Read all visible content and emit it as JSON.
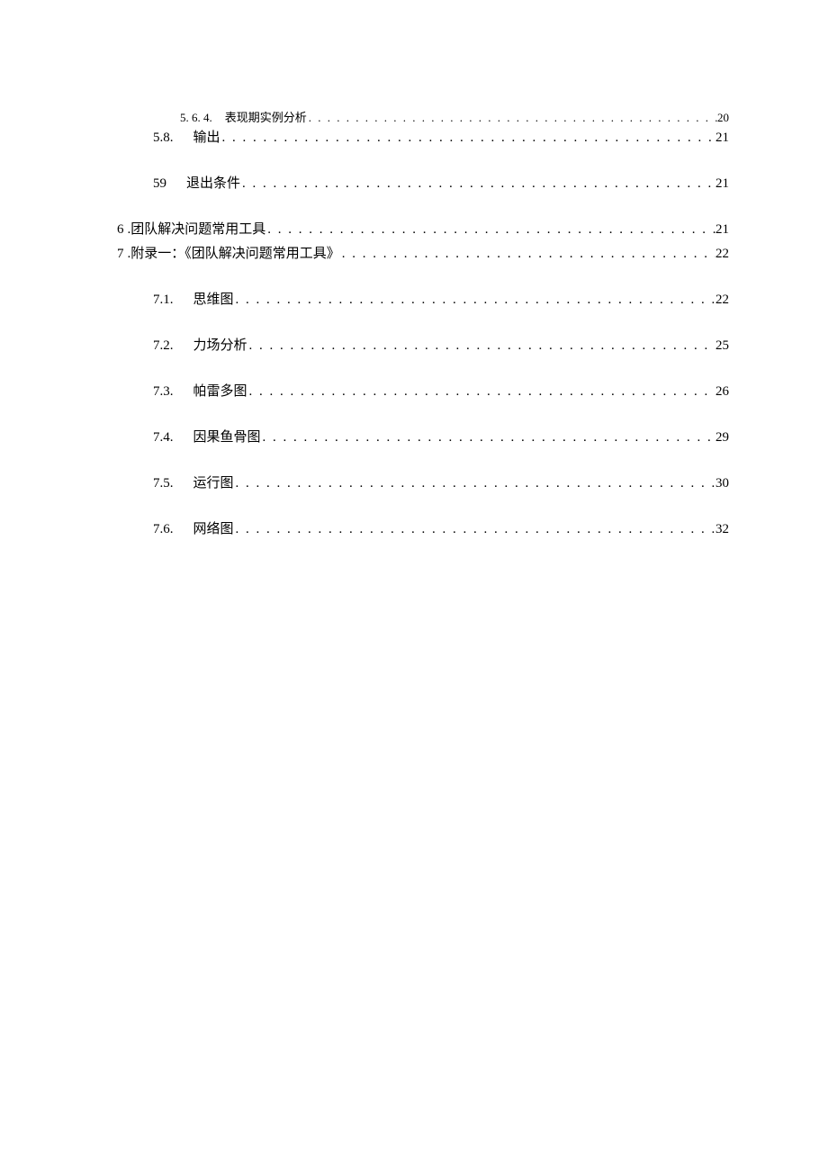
{
  "toc": [
    {
      "indent": 2,
      "num": "5. 6. 4.",
      "title": "表现期实例分析",
      "page": "20",
      "gap": "gap-top"
    },
    {
      "indent": 1,
      "num": "5.8.",
      "title": "输出",
      "page": "21",
      "gap": "gap-large"
    },
    {
      "indent": 1,
      "num": "59",
      "title": "退出条件",
      "page": "21",
      "gap": "gap-med"
    },
    {
      "indent": 0,
      "num": "6",
      "title": ".团队解决问题常用工具",
      "page": "21",
      "gap": ""
    },
    {
      "indent": 0,
      "num": "7",
      "title": ".附录一：《团队解决问题常用工具》",
      "page": "22",
      "gap": "gap-med"
    },
    {
      "indent": 1,
      "num": "7.1.",
      "title": "思维图",
      "page": "22",
      "gap": "gap-large"
    },
    {
      "indent": 1,
      "num": "7.2.",
      "title": "力场分析",
      "page": "25",
      "gap": "gap-large"
    },
    {
      "indent": 1,
      "num": "7.3.",
      "title": "帕雷多图",
      "page": "26",
      "gap": "gap-large"
    },
    {
      "indent": 1,
      "num": "7.4.",
      "title": "因果鱼骨图",
      "page": "29",
      "gap": "gap-large"
    },
    {
      "indent": 1,
      "num": "7.5.",
      "title": "运行图",
      "page": "30",
      "gap": "gap-large"
    },
    {
      "indent": 1,
      "num": "7.6.",
      "title": "网络图",
      "page": "32",
      "gap": ""
    }
  ]
}
